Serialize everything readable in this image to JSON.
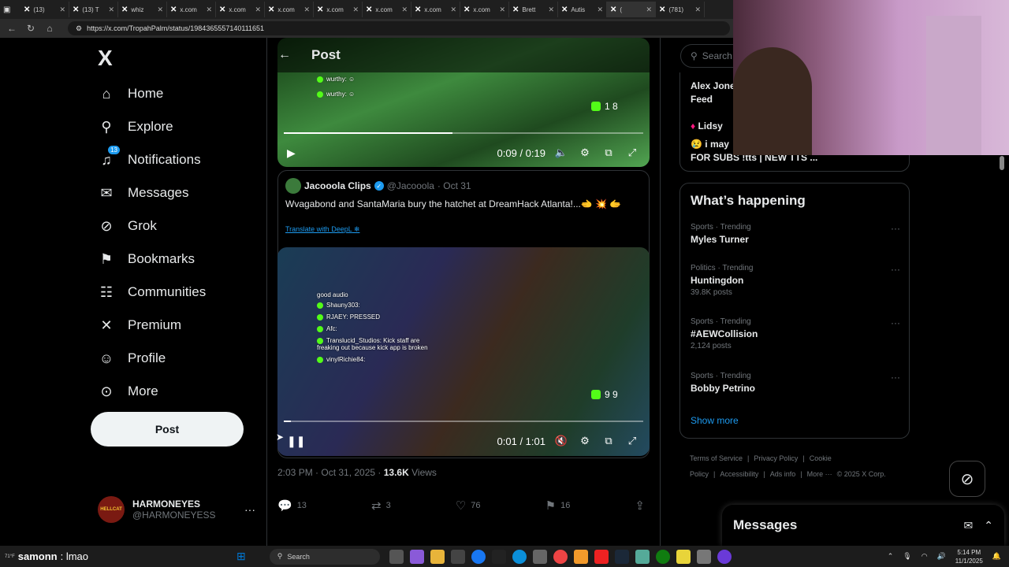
{
  "browser": {
    "tabs": [
      {
        "title": "(13)",
        "active": false
      },
      {
        "title": "(13) T",
        "active": false
      },
      {
        "title": "whiz",
        "active": false
      },
      {
        "title": "x.com",
        "active": false
      },
      {
        "title": "x.com",
        "active": false
      },
      {
        "title": "x.com",
        "active": false
      },
      {
        "title": "x.com",
        "active": false
      },
      {
        "title": "x.com",
        "active": false
      },
      {
        "title": "x.com",
        "active": false
      },
      {
        "title": "x.com",
        "active": false
      },
      {
        "title": "Brett",
        "active": false
      },
      {
        "title": "Autis",
        "active": false
      },
      {
        "title": "(",
        "active": true
      },
      {
        "title": "(781)",
        "active": false
      }
    ],
    "url": "https://x.com/TropahPalm/status/1984365557140111651"
  },
  "sidebar": {
    "logo": "X",
    "items": [
      {
        "label": "Home",
        "icon": "home-icon",
        "glyph": "⌂"
      },
      {
        "label": "Explore",
        "icon": "search-icon",
        "glyph": "⚲"
      },
      {
        "label": "Notifications",
        "icon": "bell-icon",
        "glyph": "♫",
        "badge": "13"
      },
      {
        "label": "Messages",
        "icon": "envelope-icon",
        "glyph": "✉"
      },
      {
        "label": "Grok",
        "icon": "grok-icon",
        "glyph": "⊘"
      },
      {
        "label": "Bookmarks",
        "icon": "bookmark-icon",
        "glyph": "⚑"
      },
      {
        "label": "Communities",
        "icon": "communities-icon",
        "glyph": "☷"
      },
      {
        "label": "Premium",
        "icon": "x-premium-icon",
        "glyph": "✕"
      },
      {
        "label": "Profile",
        "icon": "person-icon",
        "glyph": "☺"
      },
      {
        "label": "More",
        "icon": "more-circle-icon",
        "glyph": "⊙"
      }
    ],
    "post_button": "Post",
    "profile": {
      "name": "HARMONEYES",
      "handle": "@HARMONEYESS",
      "avatar_text": "HELLCAT",
      "more": "···"
    }
  },
  "main": {
    "header_title": "Post",
    "video1": {
      "chat": [
        "wurthy:",
        "wurthy:"
      ],
      "viewers": "1 8",
      "time": "0:09 / 0:19",
      "progress": 0.47
    },
    "tweet": {
      "name": "Jacooola Clips",
      "handle": "@Jacooola",
      "date": "· Oct 31",
      "text": "Wvagabond and SantaMaria bury the hatchet at DreamHack Atlanta!...🫲 💥 🫱",
      "translate": "Translate with DeepL"
    },
    "video2": {
      "chat": [
        "good audio",
        "Shauny303:",
        "RJAEY: PRESSED",
        "Afc:",
        "Translucid_Studios: Kick staff are freaking out because kick app is broken",
        "vinylRichie84:"
      ],
      "viewers": "9 9",
      "time": "0:01 / 1:01",
      "progress": 0.02
    },
    "meta": {
      "time": "2:03 PM · Oct 31, 2025 ·",
      "views_count": "13.6K",
      "views_label": "Views"
    },
    "actions": [
      {
        "name": "reply",
        "icon": "reply-icon",
        "glyph": "💬",
        "count": "13"
      },
      {
        "name": "repost",
        "icon": "repost-icon",
        "glyph": "⇄",
        "count": "3"
      },
      {
        "name": "like",
        "icon": "heart-icon",
        "glyph": "♡",
        "count": "76"
      },
      {
        "name": "bookmark",
        "icon": "bookmark-icon",
        "glyph": "⚑",
        "count": "16"
      },
      {
        "name": "share",
        "icon": "share-icon",
        "glyph": "⇪",
        "count": ""
      }
    ]
  },
  "right": {
    "search_placeholder": "Search",
    "live": {
      "line1": "Alex Jone",
      "line2": "Feed",
      "line3": "Lidsy",
      "line4": "😢 i may",
      "line5": "FOR SUBS !tts | NEW TTS ..."
    },
    "trends_title": "What’s happening",
    "trends": [
      {
        "category": "Sports · Trending",
        "title": "Myles Turner",
        "count": ""
      },
      {
        "category": "Politics · Trending",
        "title": "Huntingdon",
        "count": "39.8K posts"
      },
      {
        "category": "Sports · Trending",
        "title": "#AEWCollision",
        "count": "2,124 posts"
      },
      {
        "category": "Sports · Trending",
        "title": "Bobby Petrino",
        "count": ""
      }
    ],
    "show_more": "Show more",
    "footer": [
      "Terms of Service",
      "|",
      "Privacy Policy",
      "|",
      "Cookie Policy",
      "|",
      "Accessibility",
      "|",
      "Ads info",
      "|",
      "More ···",
      "© 2025 X Corp."
    ],
    "messages_title": "Messages"
  },
  "taskbar": {
    "temp": "71°F",
    "chat_user": "samonn",
    "chat_msg": ": lmao",
    "search": "Search",
    "time": "5:14 PM",
    "date": "11/1/2025"
  }
}
